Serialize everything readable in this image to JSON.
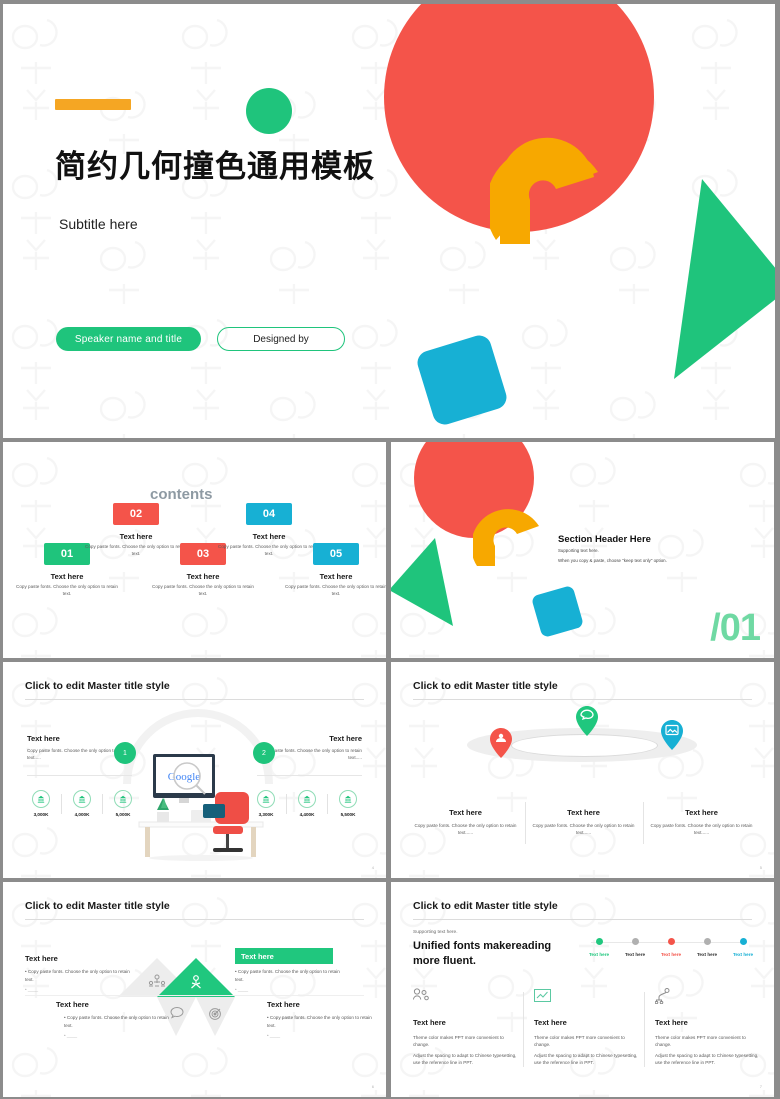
{
  "theme": {
    "red": "#f4544a",
    "green": "#1fc47c",
    "green_light": "#6fd9a3",
    "orange": "#f5a623",
    "blue": "#17b0d4",
    "gray": "#b0b0b0",
    "deck_background": "#8c8c8c",
    "slide_background": "#ffffff"
  },
  "watermark": {
    "text": "小牛办公"
  },
  "slide1": {
    "title": "简约几何撞色通用模板",
    "subtitle": "Subtitle here",
    "speaker_pill": "Speaker name and title",
    "designer_pill": "Designed by",
    "shapes": [
      "orange-bar",
      "green-circle",
      "red-circle",
      "orange-arc",
      "green-triangle",
      "blue-rounded-square"
    ]
  },
  "slide2": {
    "heading": "contents",
    "items": [
      {
        "number": "01",
        "color": "#1fc47c",
        "title": "Text here",
        "desc": "Copy paste fonts. Choose the only option to retain text."
      },
      {
        "number": "02",
        "color": "#f4544a",
        "title": "Text here",
        "desc": "Copy paste fonts. Choose the only option to retain text."
      },
      {
        "number": "03",
        "color": "#f4544a",
        "title": "Text here",
        "desc": "Copy paste fonts. Choose the only option to retain text."
      },
      {
        "number": "04",
        "color": "#17b0d4",
        "title": "Text here",
        "desc": "Copy paste fonts. Choose the only option to retain text."
      },
      {
        "number": "05",
        "color": "#17b0d4",
        "title": "Text here",
        "desc": "Copy paste fonts. Choose the only option to retain text."
      }
    ]
  },
  "slide3": {
    "header": "Section Header Here",
    "support1": "Supporting text here.",
    "support2": "When you copy & paste, choose \"keep text only\" option.",
    "section_number": "/01"
  },
  "slide4": {
    "title": "Click to edit Master title style",
    "page": "4",
    "left_block": {
      "marker": "1",
      "title": "Text here",
      "desc": "Copy paste fonts. Choose the only option to retain text....."
    },
    "right_block": {
      "marker": "2",
      "title": "Text here",
      "desc": "Copy paste fonts. Choose the only option to retain text....."
    },
    "left_stats": [
      "3,000K",
      "4,000K",
      "5,000K"
    ],
    "right_stats": [
      "3,300K",
      "4,400K",
      "5,500K"
    ],
    "illustration": "desk-computer-chair-illustration",
    "screen_logo": "Google"
  },
  "slide5": {
    "title": "Click to edit Master title style",
    "page": "5",
    "pins": [
      {
        "color": "#f4544a",
        "icon": "users-icon"
      },
      {
        "color": "#20c77e",
        "icon": "chat-icon"
      },
      {
        "color": "#17b0d4",
        "icon": "image-icon"
      }
    ],
    "columns": [
      {
        "title": "Text here",
        "desc": "Copy paste fonts. Choose the only option to retain text......"
      },
      {
        "title": "Text here",
        "desc": "Copy paste fonts. Choose the only option to retain text......"
      },
      {
        "title": "Text here",
        "desc": "Copy paste fonts. Choose the only option to retain text......"
      }
    ]
  },
  "slide6": {
    "title": "Click to edit Master title style",
    "page": "6",
    "blocks": [
      {
        "title": "Text here",
        "desc": "Copy paste fonts. Choose the only option to retain text.",
        "highlight": false
      },
      {
        "title": "Text here",
        "desc": "Copy paste fonts. Choose the only option to retain text.",
        "highlight": true
      },
      {
        "title": "Text here",
        "desc": "Copy paste fonts. Choose the only option to retain text.",
        "highlight": false
      },
      {
        "title": "Text here",
        "desc": "Copy paste fonts. Choose the only option to retain text.",
        "highlight": false
      }
    ],
    "triangle_icons": [
      "team-icon",
      "tools-icon",
      "chat-icon",
      "target-icon"
    ]
  },
  "slide7": {
    "title": "Click to edit Master title style",
    "page": "7",
    "supporting": "Supporting text here.",
    "headline_line1": "Unified fonts makereading",
    "headline_line2": "more fluent.",
    "timeline": [
      {
        "label": "Text here",
        "color": "#20c77e"
      },
      {
        "label": "Text here",
        "color": "#b0b0b0"
      },
      {
        "label": "Text here",
        "color": "#f4544a"
      },
      {
        "label": "Text here",
        "color": "#b0b0b0"
      },
      {
        "label": "Text here",
        "color": "#17b0d4"
      }
    ],
    "columns": [
      {
        "icon": "people-icon",
        "title": "Text here",
        "line1": "Theme color makes PPT more convenient to change.",
        "line2": "Adjust the spacing to adapt to Chinese typesetting, use the reference line in PPT."
      },
      {
        "icon": "chart-icon",
        "title": "Text here",
        "line1": "Theme color makes PPT more convenient to change.",
        "line2": "Adjust the spacing to adapt to Chinese typesetting, use the reference line in PPT."
      },
      {
        "icon": "network-icon",
        "title": "Text here",
        "line1": "Theme color makes PPT more convenient to change.",
        "line2": "Adjust the spacing to adapt to Chinese typesetting, use the reference line in PPT."
      }
    ]
  }
}
